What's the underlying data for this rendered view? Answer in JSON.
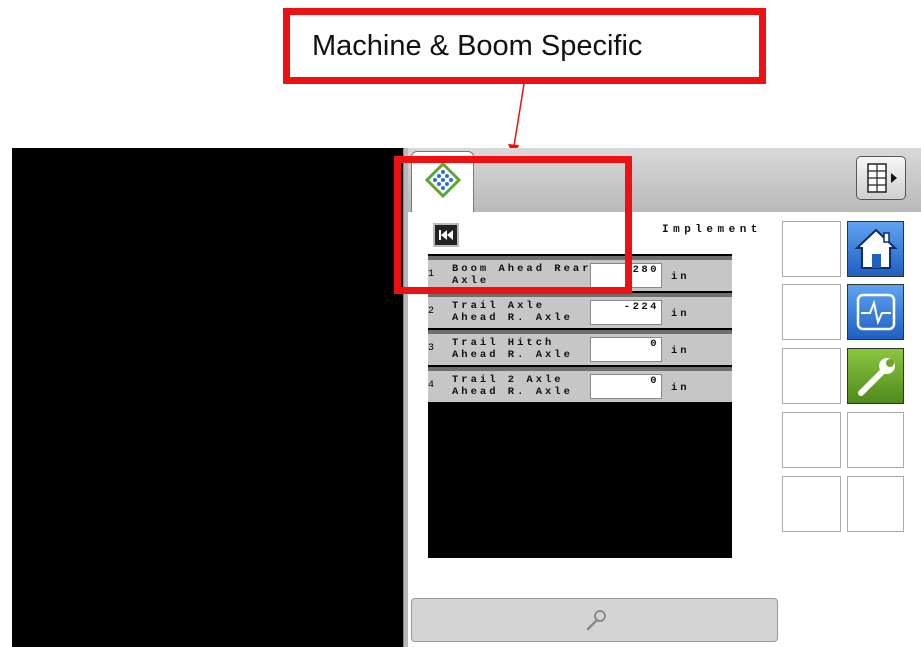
{
  "callout": {
    "text": "Machine & Boom Specific"
  },
  "header": {
    "active_tab_icon": "implement-diamond-icon",
    "grid_button_icon": "grid-menu-icon"
  },
  "implement": {
    "title": "Implement",
    "rows": [
      {
        "number": "1",
        "label": "Boom Ahead Rear Axle",
        "value": "280",
        "unit": "in"
      },
      {
        "number": "2",
        "label": "Trail Axle Ahead R. Axle",
        "value": "-224",
        "unit": "in"
      },
      {
        "number": "3",
        "label": "Trail Hitch Ahead R. Axle",
        "value": "0",
        "unit": "in"
      },
      {
        "number": "4",
        "label": "Trail 2 Axle Ahead R. Axle",
        "value": "0",
        "unit": "in"
      }
    ]
  },
  "side_buttons": [
    "home-icon",
    "diagnostics-icon",
    "wrench-settings-icon"
  ],
  "footer": {
    "tool_icon": "wrench-icon"
  },
  "colors": {
    "highlight": "#ee1111",
    "accent_blue": "#2a6fd6",
    "accent_green": "#6aa82a"
  }
}
